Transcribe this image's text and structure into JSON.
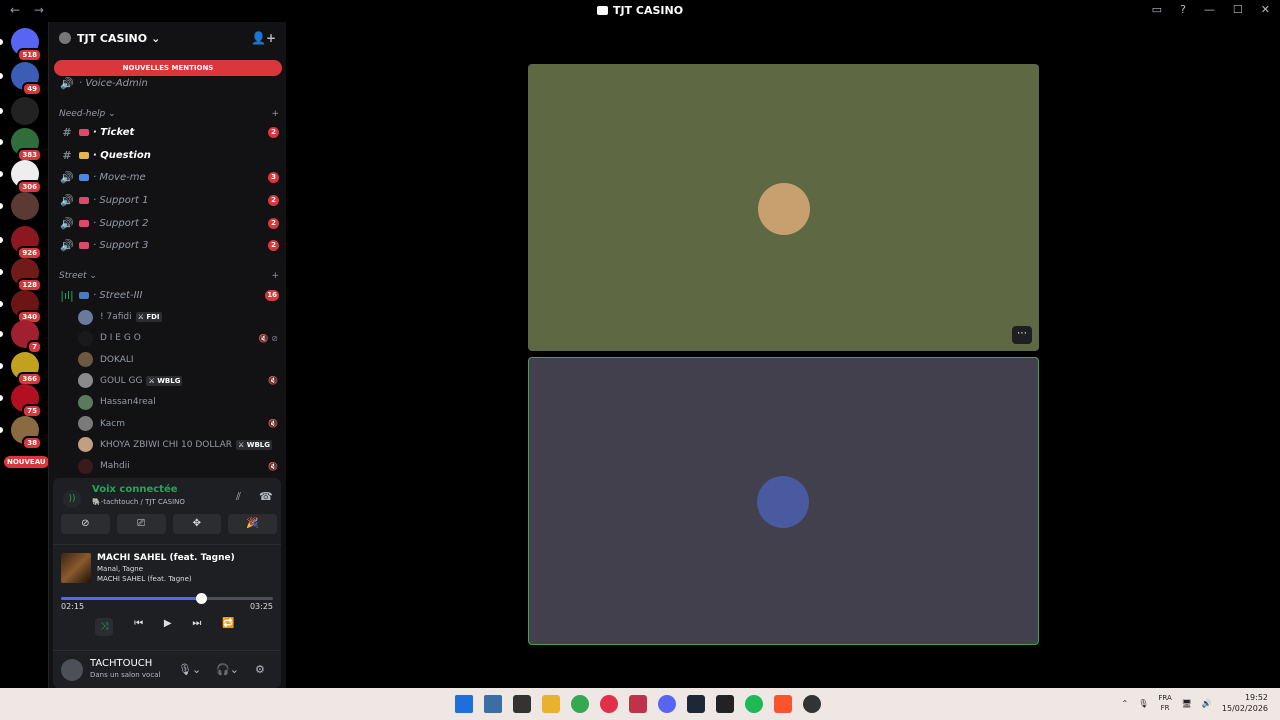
{
  "window": {
    "title": "TJT CASINO",
    "nav_back": "←",
    "nav_forward": "→",
    "controls": [
      "▭",
      "?",
      "—",
      "☐",
      "✕"
    ]
  },
  "servers": [
    {
      "badge": "518",
      "color": "#5865f2"
    },
    {
      "badge": "49",
      "color": "#3b5db5"
    },
    {
      "badge": "",
      "color": "#222"
    },
    {
      "badge": "383",
      "color": "#2f6d3b"
    },
    {
      "badge": "306",
      "color": "#eeeeee"
    },
    {
      "badge": "",
      "color": "#5a3a32"
    },
    {
      "badge": "926",
      "color": "#8a1820"
    },
    {
      "badge": "128",
      "color": "#701a1a"
    },
    {
      "badge": "340",
      "color": "#6b1515"
    },
    {
      "badge": "7",
      "color": "#a02030"
    },
    {
      "badge": "366",
      "color": "#c2a020"
    },
    {
      "badge": "75",
      "color": "#b01020"
    },
    {
      "badge": "38",
      "color": "#8a6a40"
    }
  ],
  "nouveau": "NOUVEAU",
  "guild": {
    "name": "TJT CASINO",
    "mentions": "NOUVELLES MENTIONS",
    "voice_admin": "Voice-Admin",
    "categories": {
      "need_help": "Need-help",
      "street": "Street"
    },
    "channels": [
      {
        "icon": "#",
        "emo": "#e0486a",
        "name": "Ticket",
        "bold": true,
        "count": "2"
      },
      {
        "icon": "#",
        "emo": "#e8b54a",
        "name": "Question",
        "bold": true,
        "count": ""
      },
      {
        "icon": "🔊",
        "emo": "#4a8ae0",
        "name": "Move-me",
        "bold": false,
        "count": "3"
      },
      {
        "icon": "🔊",
        "emo": "#e0486a",
        "name": "Support 1",
        "bold": false,
        "count": "2"
      },
      {
        "icon": "🔊",
        "emo": "#e0486a",
        "name": "Support 2",
        "bold": false,
        "count": "2"
      },
      {
        "icon": "🔊",
        "emo": "#e0486a",
        "name": "Support 3",
        "bold": false,
        "count": "2"
      }
    ],
    "street_channel": {
      "name": "Street-III",
      "count": "16"
    },
    "members": [
      {
        "name": "! 7afidi",
        "tag": "FDI",
        "mic": "",
        "color": "#6a7a9a"
      },
      {
        "name": "D I E G O",
        "tag": "",
        "mic": "🔇 ⊘",
        "color": "#1a1a1a"
      },
      {
        "name": "DOKALI",
        "tag": "",
        "mic": "",
        "color": "#6b5a40"
      },
      {
        "name": "GOUL GG",
        "tag": "WBLG",
        "mic": "🔇",
        "color": "#8a8a8a"
      },
      {
        "name": "Hassan4real",
        "tag": "",
        "mic": "",
        "color": "#5a7a60"
      },
      {
        "name": "Kacm",
        "tag": "",
        "mic": "🔇",
        "color": "#7a7a7a"
      },
      {
        "name": "KHOYA ZBIWI CHI 10 DOLLAR",
        "tag": "WBLG",
        "mic": "",
        "color": "#c0a080"
      },
      {
        "name": "Mahdii",
        "tag": "",
        "mic": "🔇",
        "color": "#3a1a1a"
      }
    ]
  },
  "voice": {
    "status": "Voix connectée",
    "location": "🐘-tachtouch / TJT CASINO",
    "buttons": [
      "⊘",
      "⎚",
      "✥",
      "🎉"
    ]
  },
  "now_playing": {
    "title": "MACHI SAHEL (feat. Tagne)",
    "artists": "Manal, Tagne",
    "album": "MACHI SAHEL (feat. Tagne)",
    "elapsed": "02:15",
    "duration": "03:25",
    "progress": 0.66
  },
  "user": {
    "name": "TACHTOUCH",
    "status": "Dans un salon vocal"
  },
  "stage": {
    "tiles": [
      {
        "bg": "#5e6944",
        "border": "#5e6944",
        "avatar": "#c8a070"
      },
      {
        "bg": "#42404d",
        "border": "#3ba55c",
        "avatar": "#4a5aa0"
      }
    ],
    "more": "⋯"
  },
  "taskbar": {
    "apps": [
      "#1e6fd9",
      "#3a6ea5",
      "#333333",
      "#e8b22c",
      "#34a853",
      "#e0304a",
      "#c0324a",
      "#5865f2",
      "#1b2838",
      "#222222",
      "#1db954",
      "#fb542b",
      "#333333"
    ],
    "lang_top": "FRA",
    "lang_bottom": "FR",
    "time": "19:52",
    "date": "15/02/2026"
  }
}
